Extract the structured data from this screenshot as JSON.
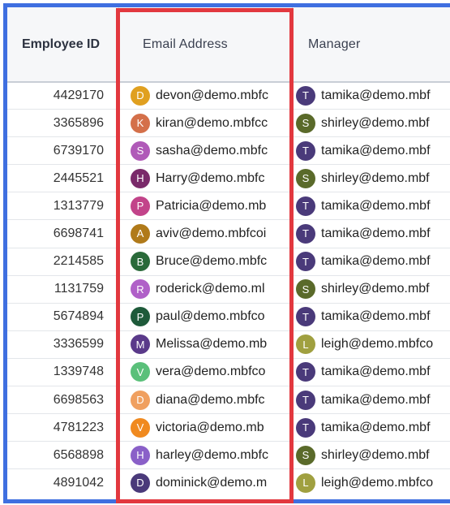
{
  "columns": {
    "employee_id": "Employee ID",
    "email": "Email Address",
    "manager": "Manager"
  },
  "rows": [
    {
      "id": "4429170",
      "email": "devon@demo.mbfc",
      "initial": "D",
      "color": "#e0a020",
      "mgr": "tamika@demo.mbf",
      "mgr_initial": "T",
      "mgr_color": "#4a3a7a"
    },
    {
      "id": "3365896",
      "email": "kiran@demo.mbfcc",
      "initial": "K",
      "color": "#d4704a",
      "mgr": "shirley@demo.mbf",
      "mgr_initial": "S",
      "mgr_color": "#5a6a2a"
    },
    {
      "id": "6739170",
      "email": "sasha@demo.mbfc",
      "initial": "S",
      "color": "#b05ab8",
      "mgr": "tamika@demo.mbf",
      "mgr_initial": "T",
      "mgr_color": "#4a3a7a"
    },
    {
      "id": "2445521",
      "email": "Harry@demo.mbfc",
      "initial": "H",
      "color": "#7a2a6a",
      "mgr": "shirley@demo.mbf",
      "mgr_initial": "S",
      "mgr_color": "#5a6a2a"
    },
    {
      "id": "1313779",
      "email": "Patricia@demo.mb",
      "initial": "P",
      "color": "#c2448a",
      "mgr": "tamika@demo.mbf",
      "mgr_initial": "T",
      "mgr_color": "#4a3a7a"
    },
    {
      "id": "6698741",
      "email": "aviv@demo.mbfcoi",
      "initial": "A",
      "color": "#b07a1a",
      "mgr": "tamika@demo.mbf",
      "mgr_initial": "T",
      "mgr_color": "#4a3a7a"
    },
    {
      "id": "2214585",
      "email": "Bruce@demo.mbfc",
      "initial": "B",
      "color": "#2a6a3a",
      "mgr": "tamika@demo.mbf",
      "mgr_initial": "T",
      "mgr_color": "#4a3a7a"
    },
    {
      "id": "1131759",
      "email": "roderick@demo.ml",
      "initial": "R",
      "color": "#b060c8",
      "mgr": "shirley@demo.mbf",
      "mgr_initial": "S",
      "mgr_color": "#5a6a2a"
    },
    {
      "id": "5674894",
      "email": "paul@demo.mbfco",
      "initial": "P",
      "color": "#1e5a3a",
      "mgr": "tamika@demo.mbf",
      "mgr_initial": "T",
      "mgr_color": "#4a3a7a"
    },
    {
      "id": "3336599",
      "email": "Melissa@demo.mb",
      "initial": "M",
      "color": "#5a3a8a",
      "mgr": "leigh@demo.mbfco",
      "mgr_initial": "L",
      "mgr_color": "#a0a040"
    },
    {
      "id": "1339748",
      "email": "vera@demo.mbfco",
      "initial": "V",
      "color": "#5ac07a",
      "mgr": "tamika@demo.mbf",
      "mgr_initial": "T",
      "mgr_color": "#4a3a7a"
    },
    {
      "id": "6698563",
      "email": "diana@demo.mbfc",
      "initial": "D",
      "color": "#f0a060",
      "mgr": "tamika@demo.mbf",
      "mgr_initial": "T",
      "mgr_color": "#4a3a7a"
    },
    {
      "id": "4781223",
      "email": "victoria@demo.mb",
      "initial": "V",
      "color": "#f08a20",
      "mgr": "tamika@demo.mbf",
      "mgr_initial": "T",
      "mgr_color": "#4a3a7a"
    },
    {
      "id": "6568898",
      "email": "harley@demo.mbfc",
      "initial": "H",
      "color": "#8a60c8",
      "mgr": "shirley@demo.mbf",
      "mgr_initial": "S",
      "mgr_color": "#5a6a2a"
    },
    {
      "id": "4891042",
      "email": "dominick@demo.m",
      "initial": "D",
      "color": "#4a3a7a",
      "mgr": "leigh@demo.mbfco",
      "mgr_initial": "L",
      "mgr_color": "#a0a040"
    }
  ],
  "highlight_colors": {
    "employee_table_border": "#3f6fe0",
    "email_column_border": "#e2383f"
  }
}
